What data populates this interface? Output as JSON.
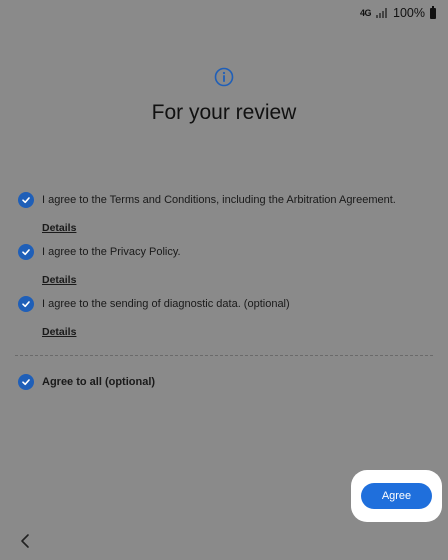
{
  "status_bar": {
    "network": "4G",
    "battery_percent": "100%"
  },
  "header": {
    "icon": "info-icon",
    "title": "For your review"
  },
  "consents": [
    {
      "label": "I agree to the Terms and Conditions, including the Arbitration Agreement.",
      "details_label": "Details",
      "checked": true
    },
    {
      "label": "I agree to the Privacy Policy.",
      "details_label": "Details",
      "checked": true
    },
    {
      "label": "I agree to the sending of diagnostic data. (optional)",
      "details_label": "Details",
      "checked": true
    }
  ],
  "agree_all": {
    "label": "Agree to all (optional)",
    "checked": true
  },
  "actions": {
    "agree_label": "Agree",
    "back_icon": "chevron-left-icon"
  },
  "colors": {
    "background": "#8a8a8a",
    "accent": "#1f6fdc",
    "check": "#1f5fb8"
  }
}
